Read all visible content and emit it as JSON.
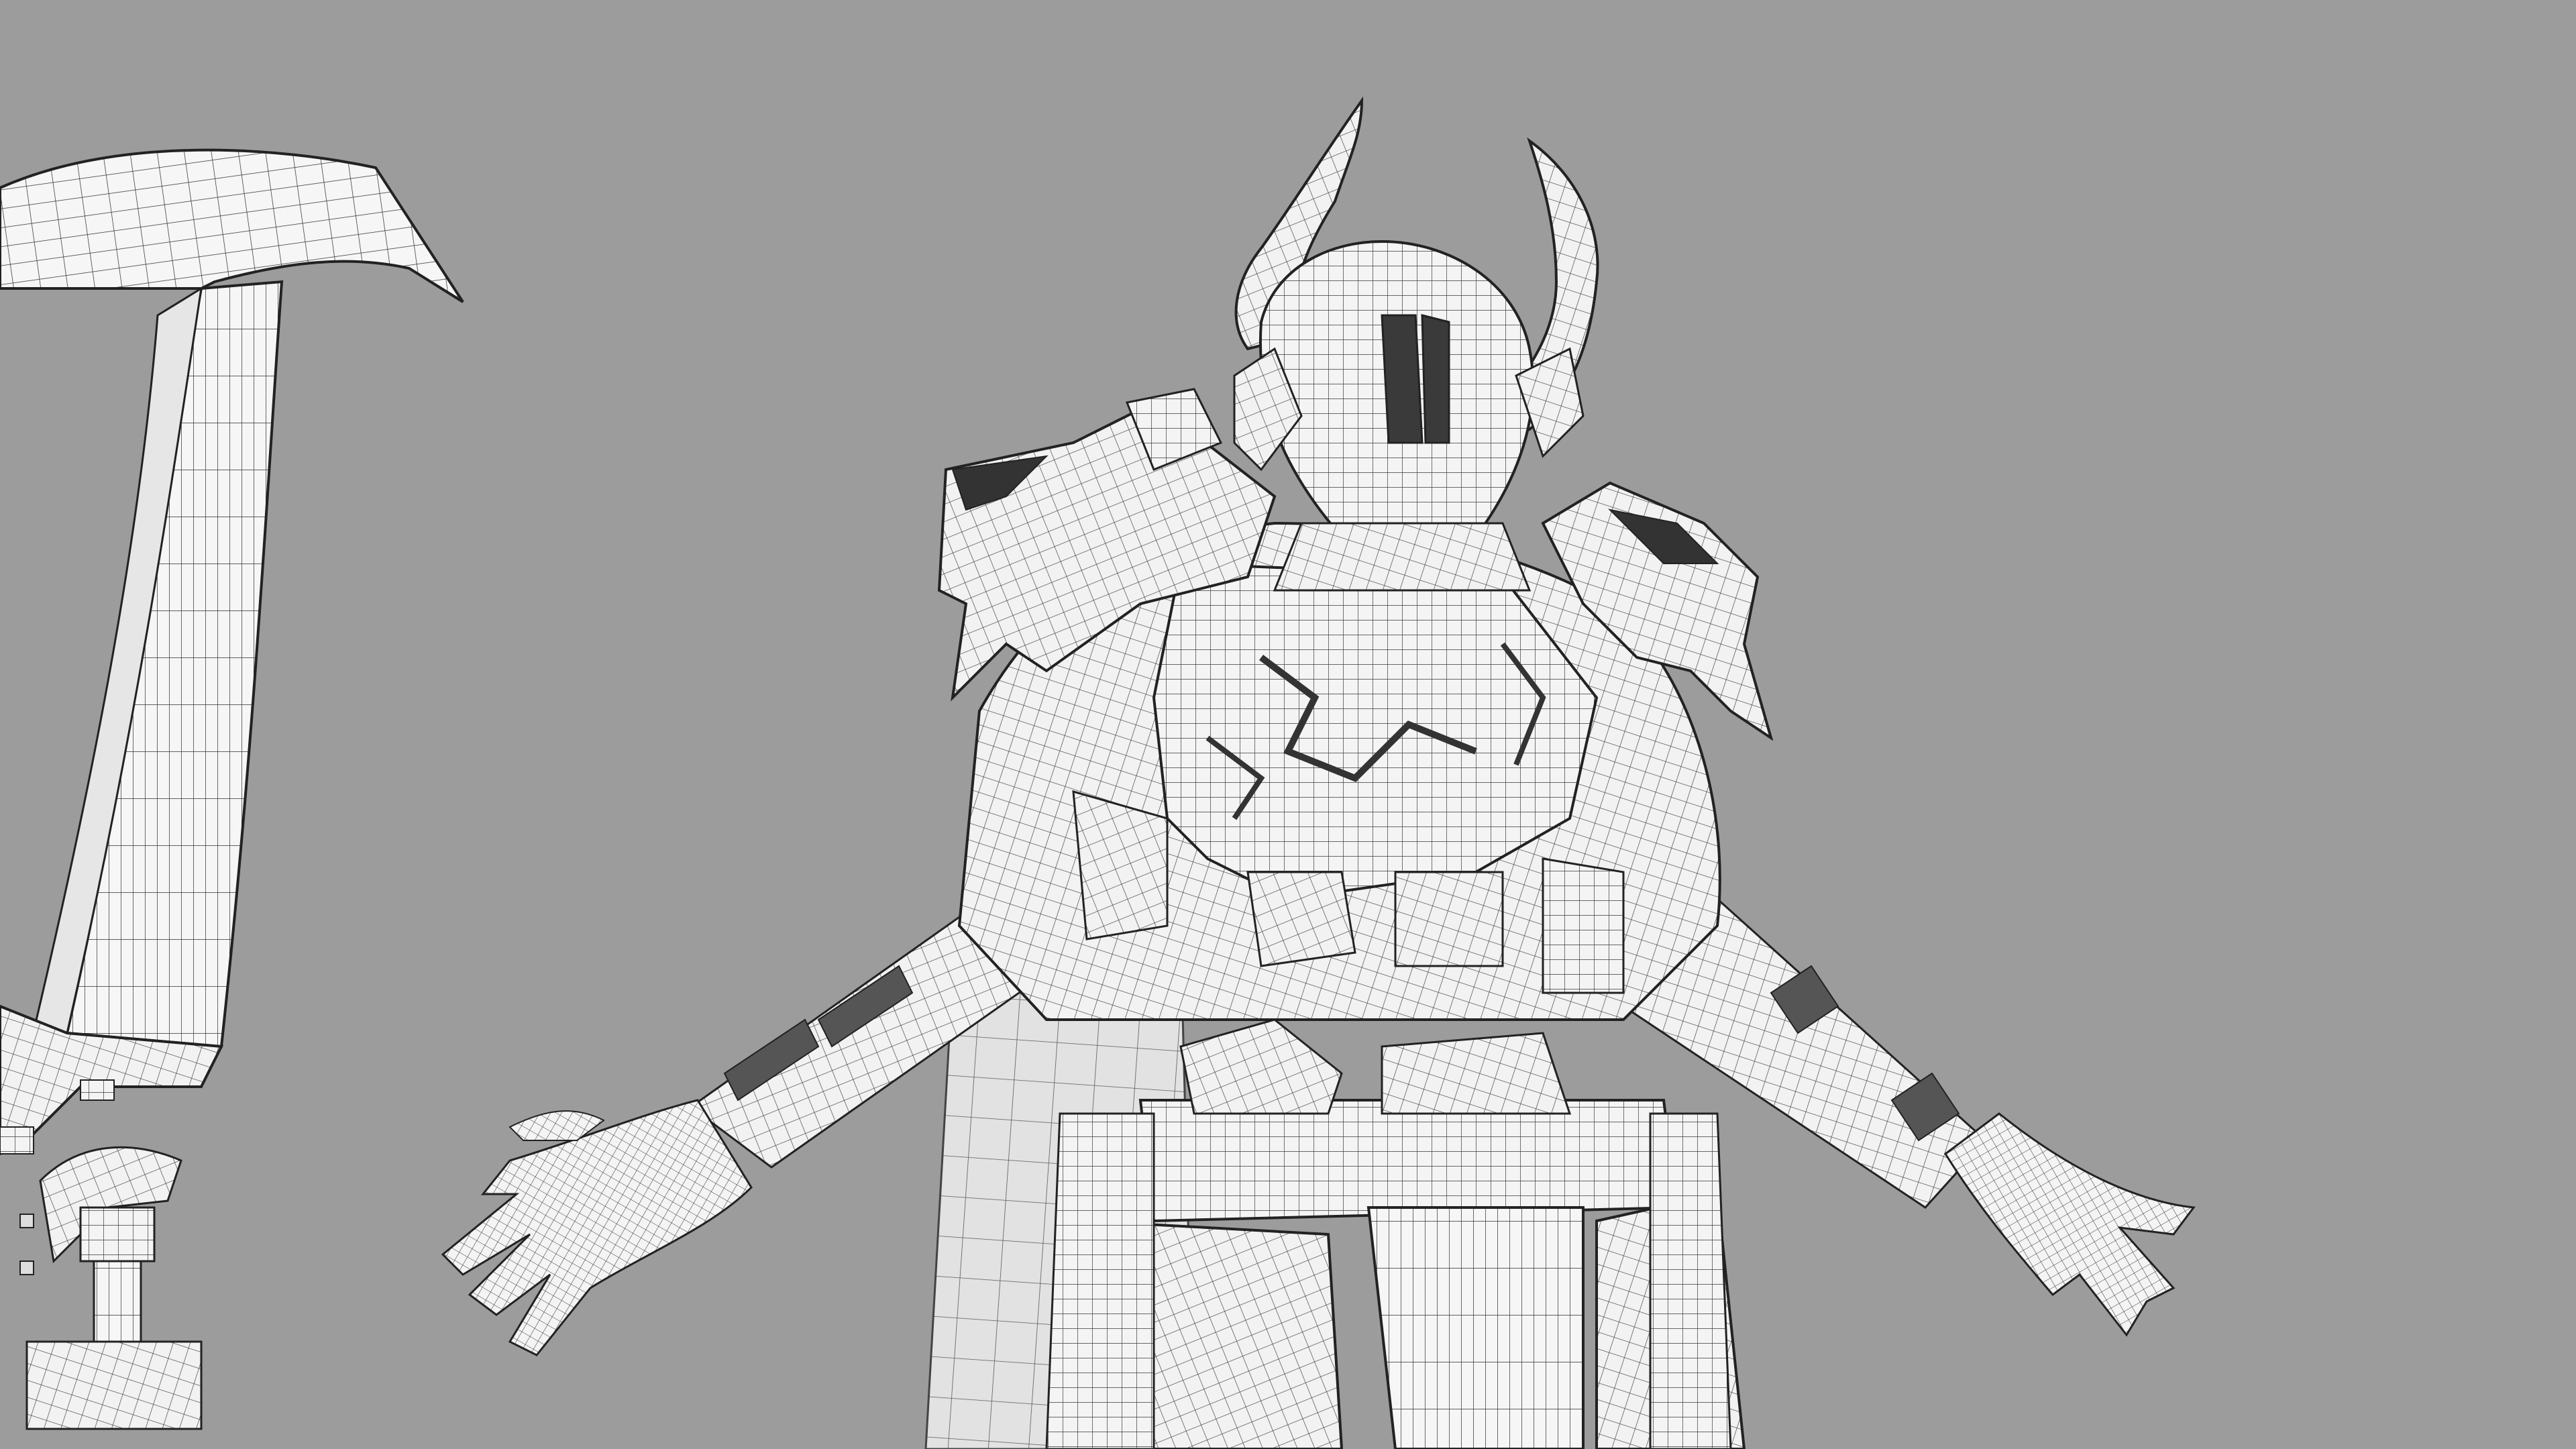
{
  "viewport": {
    "background_color": "#9c9c9c",
    "mesh_fill": "#f4f4f4",
    "mesh_shade": "#d6d6d6",
    "wire_color": "#2a2a2a",
    "wire_light": "#6a6a6a",
    "dark_slot": "#3a3a3a"
  },
  "scene": {
    "description_icon": "wireframe-3d-model",
    "subjects": [
      "armored-knight-model",
      "scythe-weapon-model"
    ]
  }
}
